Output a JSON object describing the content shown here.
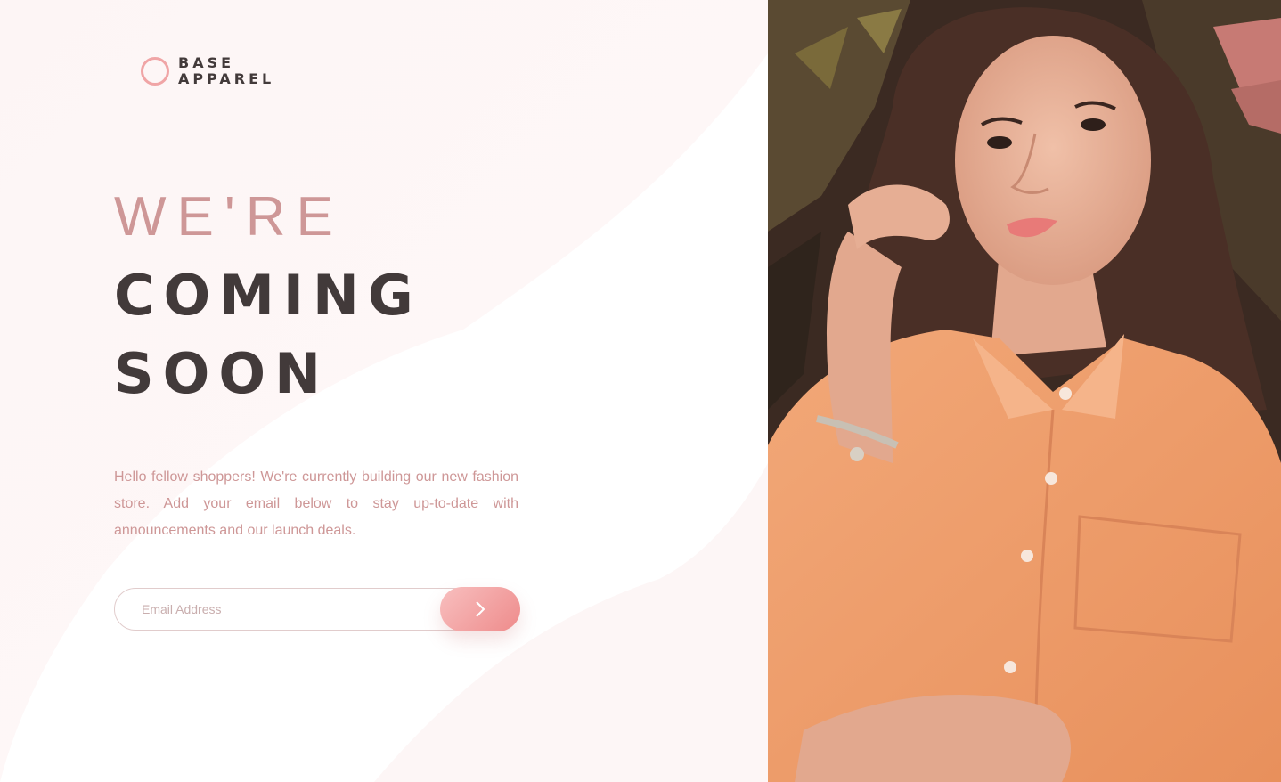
{
  "brand": {
    "line1": "BASE",
    "line2": "APPAREL",
    "accent_color": "#f0a5a6"
  },
  "headline": {
    "light": "WE'RE",
    "bold_line1": "COMING",
    "bold_line2": "SOON"
  },
  "description": "Hello fellow shoppers! We're currently building our new fashion store. Add your email below to stay up-to-date with announcements and our launch deals.",
  "form": {
    "email_placeholder": "Email Address",
    "email_value": "",
    "submit_icon": "chevron-right-icon"
  },
  "hero": {
    "image_icon": "hero-photo"
  },
  "colors": {
    "primary_text": "#423a3a",
    "desaturated_red": "#ce9797",
    "gradient_start": "#f8bfbf",
    "gradient_end": "#ee8b8b",
    "shirt": "#f0a070"
  }
}
